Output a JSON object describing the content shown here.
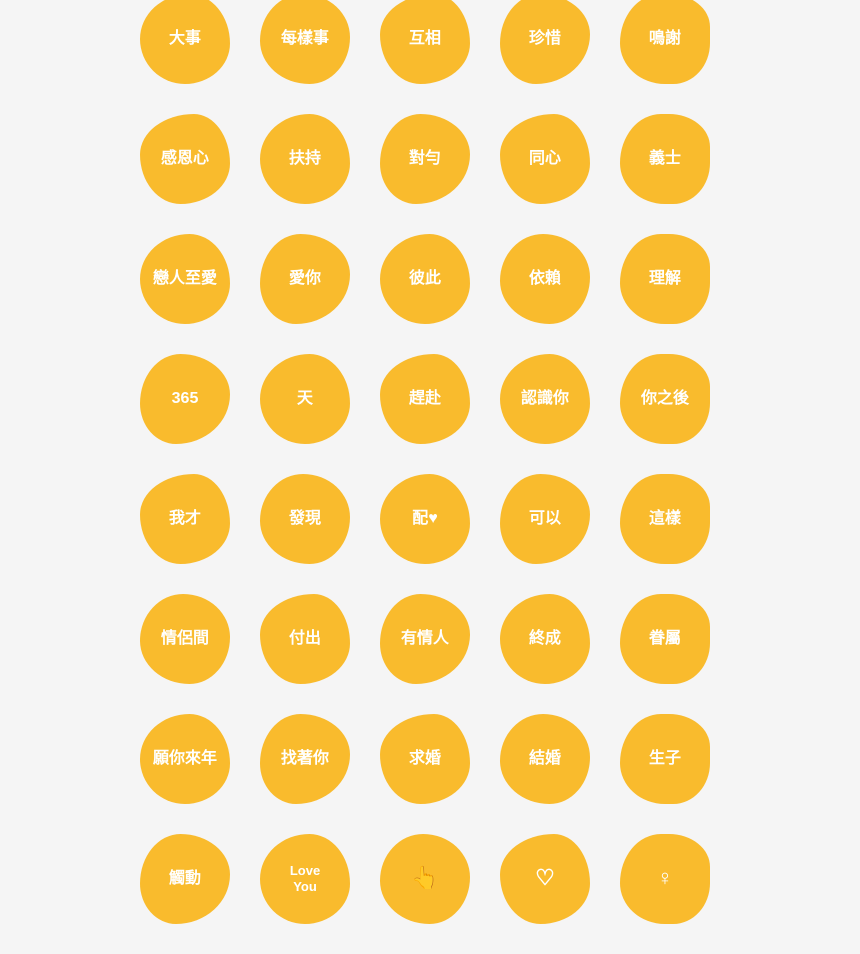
{
  "stamps": [
    {
      "id": 1,
      "text": "大事",
      "type": "zh"
    },
    {
      "id": 2,
      "text": "每樣事",
      "type": "zh"
    },
    {
      "id": 3,
      "text": "互相",
      "type": "zh"
    },
    {
      "id": 4,
      "text": "珍惜",
      "type": "zh"
    },
    {
      "id": 5,
      "text": "鳴謝",
      "type": "zh"
    },
    {
      "id": 6,
      "text": "感恩心",
      "type": "zh"
    },
    {
      "id": 7,
      "text": "扶持",
      "type": "zh"
    },
    {
      "id": 8,
      "text": "對勻",
      "type": "zh"
    },
    {
      "id": 9,
      "text": "同心",
      "type": "zh"
    },
    {
      "id": 10,
      "text": "義士",
      "type": "zh"
    },
    {
      "id": 11,
      "text": "戀人至愛",
      "type": "zh"
    },
    {
      "id": 12,
      "text": "愛你",
      "type": "zh"
    },
    {
      "id": 13,
      "text": "彼此",
      "type": "zh"
    },
    {
      "id": 14,
      "text": "依賴",
      "type": "zh"
    },
    {
      "id": 15,
      "text": "理解",
      "type": "zh"
    },
    {
      "id": 16,
      "text": "365",
      "type": "zh"
    },
    {
      "id": 17,
      "text": "天",
      "type": "zh"
    },
    {
      "id": 18,
      "text": "趕赴",
      "type": "zh"
    },
    {
      "id": 19,
      "text": "認識你",
      "type": "zh"
    },
    {
      "id": 20,
      "text": "你之後",
      "type": "zh"
    },
    {
      "id": 21,
      "text": "我才",
      "type": "zh"
    },
    {
      "id": 22,
      "text": "發現",
      "type": "zh"
    },
    {
      "id": 23,
      "text": "配♥",
      "type": "zh"
    },
    {
      "id": 24,
      "text": "可以",
      "type": "zh"
    },
    {
      "id": 25,
      "text": "這樣",
      "type": "zh"
    },
    {
      "id": 26,
      "text": "情侶間",
      "type": "zh"
    },
    {
      "id": 27,
      "text": "付出",
      "type": "zh"
    },
    {
      "id": 28,
      "text": "有情人",
      "type": "zh"
    },
    {
      "id": 29,
      "text": "終成",
      "type": "zh"
    },
    {
      "id": 30,
      "text": "眷屬",
      "type": "zh"
    },
    {
      "id": 31,
      "text": "願你來年",
      "type": "zh"
    },
    {
      "id": 32,
      "text": "找著你",
      "type": "zh"
    },
    {
      "id": 33,
      "text": "求婚",
      "type": "zh"
    },
    {
      "id": 34,
      "text": "結婚",
      "type": "zh"
    },
    {
      "id": 35,
      "text": "生子",
      "type": "zh"
    },
    {
      "id": 36,
      "text": "觸動",
      "type": "zh"
    },
    {
      "id": 37,
      "text": "Love\nYou",
      "type": "en"
    },
    {
      "id": 38,
      "text": "👆",
      "type": "icon"
    },
    {
      "id": 39,
      "text": "♡",
      "type": "icon"
    },
    {
      "id": 40,
      "text": "♀",
      "type": "icon"
    }
  ],
  "colors": {
    "stamp_bg": "#F9BB2D",
    "stamp_text": "#ffffff",
    "page_bg": "#f5f5f5"
  }
}
